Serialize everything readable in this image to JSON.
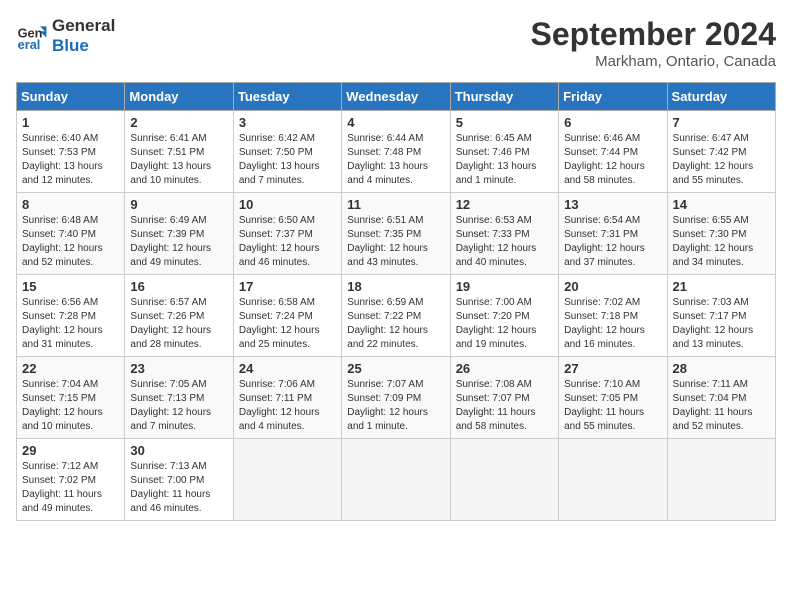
{
  "header": {
    "logo_line1": "General",
    "logo_line2": "Blue",
    "month": "September 2024",
    "location": "Markham, Ontario, Canada"
  },
  "columns": [
    "Sunday",
    "Monday",
    "Tuesday",
    "Wednesday",
    "Thursday",
    "Friday",
    "Saturday"
  ],
  "weeks": [
    [
      {
        "day": "1",
        "info": "Sunrise: 6:40 AM\nSunset: 7:53 PM\nDaylight: 13 hours\nand 12 minutes."
      },
      {
        "day": "2",
        "info": "Sunrise: 6:41 AM\nSunset: 7:51 PM\nDaylight: 13 hours\nand 10 minutes."
      },
      {
        "day": "3",
        "info": "Sunrise: 6:42 AM\nSunset: 7:50 PM\nDaylight: 13 hours\nand 7 minutes."
      },
      {
        "day": "4",
        "info": "Sunrise: 6:44 AM\nSunset: 7:48 PM\nDaylight: 13 hours\nand 4 minutes."
      },
      {
        "day": "5",
        "info": "Sunrise: 6:45 AM\nSunset: 7:46 PM\nDaylight: 13 hours\nand 1 minute."
      },
      {
        "day": "6",
        "info": "Sunrise: 6:46 AM\nSunset: 7:44 PM\nDaylight: 12 hours\nand 58 minutes."
      },
      {
        "day": "7",
        "info": "Sunrise: 6:47 AM\nSunset: 7:42 PM\nDaylight: 12 hours\nand 55 minutes."
      }
    ],
    [
      {
        "day": "8",
        "info": "Sunrise: 6:48 AM\nSunset: 7:40 PM\nDaylight: 12 hours\nand 52 minutes."
      },
      {
        "day": "9",
        "info": "Sunrise: 6:49 AM\nSunset: 7:39 PM\nDaylight: 12 hours\nand 49 minutes."
      },
      {
        "day": "10",
        "info": "Sunrise: 6:50 AM\nSunset: 7:37 PM\nDaylight: 12 hours\nand 46 minutes."
      },
      {
        "day": "11",
        "info": "Sunrise: 6:51 AM\nSunset: 7:35 PM\nDaylight: 12 hours\nand 43 minutes."
      },
      {
        "day": "12",
        "info": "Sunrise: 6:53 AM\nSunset: 7:33 PM\nDaylight: 12 hours\nand 40 minutes."
      },
      {
        "day": "13",
        "info": "Sunrise: 6:54 AM\nSunset: 7:31 PM\nDaylight: 12 hours\nand 37 minutes."
      },
      {
        "day": "14",
        "info": "Sunrise: 6:55 AM\nSunset: 7:30 PM\nDaylight: 12 hours\nand 34 minutes."
      }
    ],
    [
      {
        "day": "15",
        "info": "Sunrise: 6:56 AM\nSunset: 7:28 PM\nDaylight: 12 hours\nand 31 minutes."
      },
      {
        "day": "16",
        "info": "Sunrise: 6:57 AM\nSunset: 7:26 PM\nDaylight: 12 hours\nand 28 minutes."
      },
      {
        "day": "17",
        "info": "Sunrise: 6:58 AM\nSunset: 7:24 PM\nDaylight: 12 hours\nand 25 minutes."
      },
      {
        "day": "18",
        "info": "Sunrise: 6:59 AM\nSunset: 7:22 PM\nDaylight: 12 hours\nand 22 minutes."
      },
      {
        "day": "19",
        "info": "Sunrise: 7:00 AM\nSunset: 7:20 PM\nDaylight: 12 hours\nand 19 minutes."
      },
      {
        "day": "20",
        "info": "Sunrise: 7:02 AM\nSunset: 7:18 PM\nDaylight: 12 hours\nand 16 minutes."
      },
      {
        "day": "21",
        "info": "Sunrise: 7:03 AM\nSunset: 7:17 PM\nDaylight: 12 hours\nand 13 minutes."
      }
    ],
    [
      {
        "day": "22",
        "info": "Sunrise: 7:04 AM\nSunset: 7:15 PM\nDaylight: 12 hours\nand 10 minutes."
      },
      {
        "day": "23",
        "info": "Sunrise: 7:05 AM\nSunset: 7:13 PM\nDaylight: 12 hours\nand 7 minutes."
      },
      {
        "day": "24",
        "info": "Sunrise: 7:06 AM\nSunset: 7:11 PM\nDaylight: 12 hours\nand 4 minutes."
      },
      {
        "day": "25",
        "info": "Sunrise: 7:07 AM\nSunset: 7:09 PM\nDaylight: 12 hours\nand 1 minute."
      },
      {
        "day": "26",
        "info": "Sunrise: 7:08 AM\nSunset: 7:07 PM\nDaylight: 11 hours\nand 58 minutes."
      },
      {
        "day": "27",
        "info": "Sunrise: 7:10 AM\nSunset: 7:05 PM\nDaylight: 11 hours\nand 55 minutes."
      },
      {
        "day": "28",
        "info": "Sunrise: 7:11 AM\nSunset: 7:04 PM\nDaylight: 11 hours\nand 52 minutes."
      }
    ],
    [
      {
        "day": "29",
        "info": "Sunrise: 7:12 AM\nSunset: 7:02 PM\nDaylight: 11 hours\nand 49 minutes."
      },
      {
        "day": "30",
        "info": "Sunrise: 7:13 AM\nSunset: 7:00 PM\nDaylight: 11 hours\nand 46 minutes."
      },
      null,
      null,
      null,
      null,
      null
    ]
  ]
}
